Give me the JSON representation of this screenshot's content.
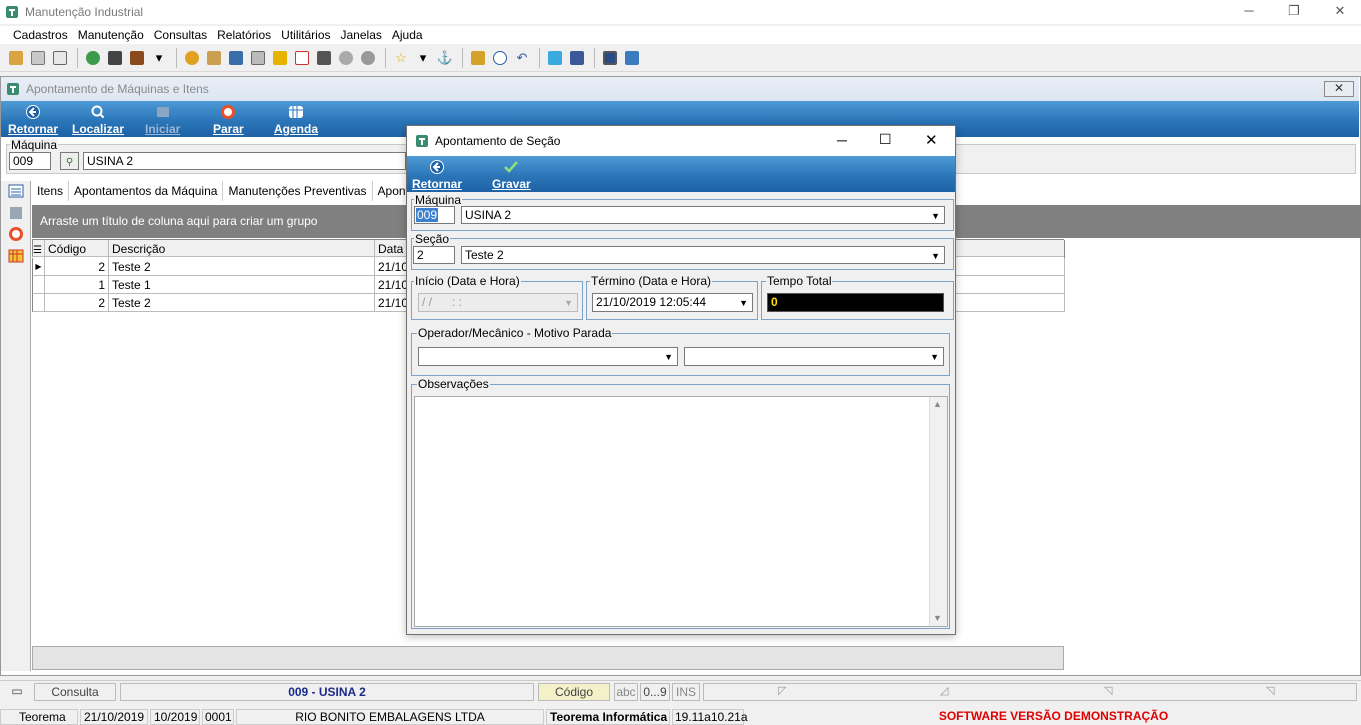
{
  "app": {
    "title": "Manutenção Industrial",
    "menu": [
      "Cadastros",
      "Manutenção",
      "Consultas",
      "Relatórios",
      "Utilitários",
      "Janelas",
      "Ajuda"
    ]
  },
  "child": {
    "title": "Apontamento de Máquinas e Itens",
    "close_label": "✕",
    "actions": {
      "retornar": "Retornar",
      "localizar": "Localizar",
      "iniciar": "Iniciar",
      "parar": "Parar",
      "agenda": "Agenda"
    },
    "maquina": {
      "label": "Máquina",
      "code": "009",
      "name": "USINA 2"
    },
    "tabs": [
      "Itens",
      "Apontamentos da Máquina",
      "Manutenções Preventivas",
      "Apontamen"
    ],
    "group_hint": "Arraste um título de coluna aqui para criar um grupo",
    "grid": {
      "headers": [
        "Código",
        "Descrição",
        "Data I"
      ],
      "rows": [
        {
          "codigo": "2",
          "descricao": "Teste 2",
          "data": "21/10"
        },
        {
          "codigo": "1",
          "descricao": "Teste 1",
          "data": "21/10"
        },
        {
          "codigo": "2",
          "descricao": "Teste 2",
          "data": "21/10"
        }
      ]
    }
  },
  "dialog": {
    "title": "Apontamento de Seção",
    "actions": {
      "retornar": "Retornar",
      "gravar": "Gravar"
    },
    "maquina": {
      "label": "Máquina",
      "code": "009",
      "name": "USINA 2"
    },
    "secao": {
      "label": "Seção",
      "code": "2",
      "name": "Teste 2"
    },
    "inicio": {
      "label": "Início (Data e Hora)",
      "value": "/ /      : :"
    },
    "termino": {
      "label": "Término (Data e Hora)",
      "value": "21/10/2019 12:05:44"
    },
    "tempo_total": {
      "label": "Tempo Total",
      "value": "0"
    },
    "operador_label": "Operador/Mecânico - Motivo Parada",
    "observacoes_label": "Observações"
  },
  "status": {
    "mode": "Consulta",
    "record": "009 - USINA 2",
    "field": "Código",
    "indicators": [
      "abc",
      "0...9",
      "INS"
    ]
  },
  "bottom": {
    "user": "Teorema",
    "date": "21/10/2019",
    "period": "10/2019",
    "company_code": "0001",
    "company": "RIO BONITO EMBALAGENS LTDA",
    "vendor": "Teorema Informática",
    "version": "19.11a10.21a",
    "demo": "SOFTWARE VERSÃO DEMONSTRAÇÃO"
  },
  "colors": {
    "accent_blue": "#2b76b8",
    "demo_red": "#e00000",
    "record_blue": "#1a2a8a"
  }
}
